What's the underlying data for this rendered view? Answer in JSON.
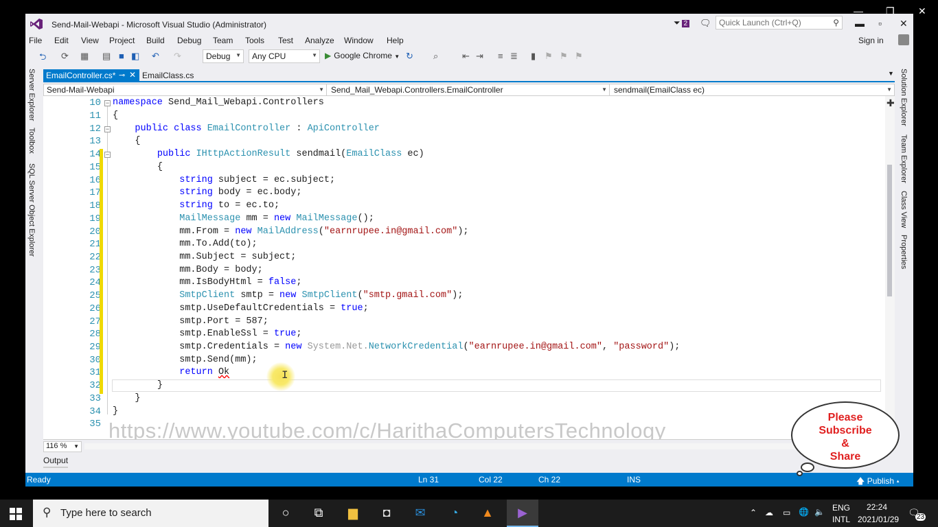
{
  "window": {
    "title": "Send-Mail-Webapi - Microsoft Visual Studio (Administrator)",
    "notifications": "2",
    "quick_launch_placeholder": "Quick Launch (Ctrl+Q)",
    "sign_in": "Sign in"
  },
  "menu": [
    "File",
    "Edit",
    "View",
    "Project",
    "Build",
    "Debug",
    "Team",
    "Tools",
    "Test",
    "Analyze",
    "Window",
    "Help"
  ],
  "toolbar": {
    "config": "Debug",
    "platform": "Any CPU",
    "run_target": "Google Chrome"
  },
  "left_tools": [
    "Server Explorer",
    "Toolbox",
    "SQL Server Object Explorer"
  ],
  "right_tools": [
    "Solution Explorer",
    "Team Explorer",
    "Class View",
    "Properties"
  ],
  "tabs": [
    {
      "label": "EmailController.cs*",
      "active": true
    },
    {
      "label": "EmailClass.cs",
      "active": false
    }
  ],
  "nav": {
    "project": "Send-Mail-Webapi",
    "class": "Send_Mail_Webapi.Controllers.EmailController",
    "member": "sendmail(EmailClass ec)"
  },
  "line_numbers": [
    "10",
    "11",
    "12",
    "13",
    "14",
    "15",
    "16",
    "17",
    "18",
    "19",
    "20",
    "21",
    "22",
    "23",
    "24",
    "25",
    "26",
    "27",
    "28",
    "29",
    "30",
    "31",
    "32",
    "33",
    "34",
    "35"
  ],
  "code": {
    "l10_kw": "namespace",
    "l10_rest": " Send_Mail_Webapi.Controllers",
    "brace_open": "{",
    "brace_close": "}",
    "l12_kw": "public class ",
    "l12_ty": "EmailController",
    "l12_sep": " : ",
    "l12_base": "ApiController",
    "l14_kw": "public ",
    "l14_ty": "IHttpActionResult",
    "l14_mid": " sendmail(",
    "l14_param_ty": "EmailClass",
    "l14_end": " ec)",
    "kw_string": "string",
    "l16_rest": " subject = ec.subject;",
    "l17_rest": " body = ec.body;",
    "l18_rest": " to = ec.to;",
    "ty_mailmessage": "MailMessage",
    "l19_mid": " mm = ",
    "kw_new": "new",
    "l19_end": "();",
    "l20_a": "mm.From = ",
    "ty_mailaddress": "MailAddress",
    "l20_str": "\"earnrupee.in@gmail.com\"",
    "l20_end": ");",
    "l21": "mm.To.Add(to);",
    "l22": "mm.Subject = subject;",
    "l23": "mm.Body = body;",
    "l24_a": "mm.IsBodyHtml = ",
    "kw_false": "false",
    "semi": ";",
    "ty_smtp": "SmtpClient",
    "l25_mid": " smtp = ",
    "l25_str": "\"smtp.gmail.com\"",
    "l26_a": "smtp.UseDefaultCredentials = ",
    "kw_true": "true",
    "l27": "smtp.Port = 587;",
    "l28_a": "smtp.EnableSsl = ",
    "l29_a": "smtp.Credentials = ",
    "l29_ns": "System.Net.",
    "ty_netcred": "NetworkCredential",
    "l29_str1": "\"earnrupee.in@gmail.com\"",
    "l29_comma": ", ",
    "l29_str2": "\"password\"",
    "l29_end": ");",
    "l30": "smtp.Send(mm);",
    "kw_return": "return ",
    "l31_ok": "Ok"
  },
  "watermark": "https://www.youtube.com/c/HarithaComputersTechnology",
  "zoom": "116 %",
  "output_tab": "Output",
  "status": {
    "ready": "Ready",
    "ln": "Ln 31",
    "col": "Col 22",
    "ch": "Ch 22",
    "mode": "INS",
    "publish": "Publish"
  },
  "bubble": [
    "Please",
    "Subscribe",
    "&",
    "Share"
  ],
  "taskbar": {
    "search_placeholder": "Type here to search",
    "lang1": "ENG",
    "lang2": "INTL",
    "time": "22:24",
    "date": "2021/01/29",
    "notif_count": "23"
  },
  "colors": {
    "accent": "#007acc",
    "keyword": "#0000ff",
    "type": "#2b91af",
    "string": "#a31515",
    "bubble_text": "#e02020"
  }
}
